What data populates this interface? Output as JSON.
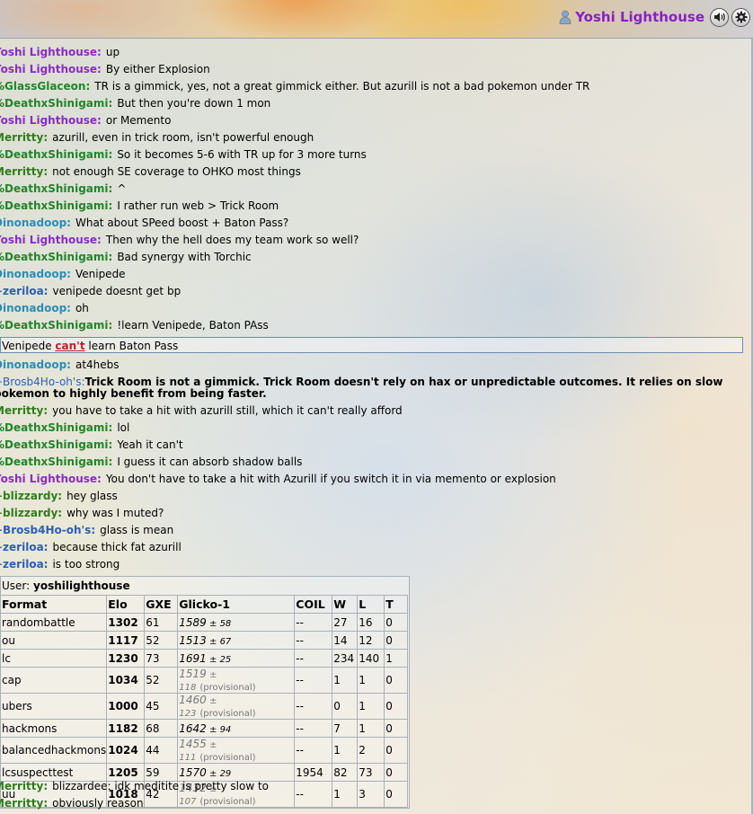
{
  "header": {
    "username": "Yoshi Lighthouse",
    "icons": {
      "user": "user-icon",
      "sound": "sound-icon",
      "settings": "gear-icon"
    },
    "username_color": "#8a1ec9"
  },
  "chat": {
    "messages": [
      {
        "name": "Yoshi Lighthouse:",
        "text": "up",
        "color": "purple"
      },
      {
        "name": "Yoshi Lighthouse:",
        "text": "By either Explosion",
        "color": "purple"
      },
      {
        "name": "%GlassGlaceon:",
        "text": "TR is a gimmick, yes, not a great gimmick either. But azurill is not a bad pokemon under TR",
        "color": "green"
      },
      {
        "name": "%DeathxShinigami:",
        "text": "But then you're down 1 mon",
        "color": "green"
      },
      {
        "name": "Yoshi Lighthouse:",
        "text": "or Memento",
        "color": "purple"
      },
      {
        "name": "Merritty:",
        "text": "azurill, even in trick room, isn't powerful enough",
        "color": "olive"
      },
      {
        "name": "%DeathxShinigami:",
        "text": "So it becomes 5-6 with TR up for 3 more turns",
        "color": "green"
      },
      {
        "name": "Merritty:",
        "text": "not enough SE coverage to OHKO most things",
        "color": "olive"
      },
      {
        "name": "%DeathxShinigami:",
        "text": "^",
        "color": "green"
      },
      {
        "name": "%DeathxShinigami:",
        "text": "I rather run web > Trick Room",
        "color": "green"
      },
      {
        "name": "Dinonadoop:",
        "text": "What about SPeed boost + Baton Pass?",
        "color": "teal"
      },
      {
        "name": "Yoshi Lighthouse:",
        "text": "Then why the hell does my team work so well?",
        "color": "purple"
      },
      {
        "name": "%DeathxShinigami:",
        "text": "Bad synergy with Torchic",
        "color": "green"
      },
      {
        "name": "Dinonadoop:",
        "text": "Venipede",
        "color": "teal"
      },
      {
        "name": "+zeriloa:",
        "text": "venipede doesnt get bp",
        "color": "blue"
      },
      {
        "name": "Dinonadoop:",
        "text": "oh",
        "color": "teal"
      },
      {
        "name": "%DeathxShinigami:",
        "text": "!learn Venipede, Baton PAss",
        "color": "green"
      }
    ],
    "command_output": {
      "before": "Venipede ",
      "cant": "can't",
      "after": " learn Baton Pass"
    },
    "messages2": [
      {
        "name": "Dinonadoop:",
        "text": "at4hebs",
        "color": "teal"
      }
    ],
    "multiline": {
      "name": "+Brosb4Ho-oh's:",
      "line1": "Trick Room is not a gimmick. Trick Room doesn't rely on hax or unpredictable outcomes. It relies on slow",
      "line2": "pokemon to highly benefit from being faster."
    },
    "messages3": [
      {
        "name": "Merritty:",
        "text": "you have to take a hit with azurill still, which it can't really afford",
        "color": "olive"
      },
      {
        "name": "%DeathxShinigami:",
        "text": "lol",
        "color": "green"
      },
      {
        "name": "%DeathxShinigami:",
        "text": "Yeah it can't",
        "color": "green"
      },
      {
        "name": "%DeathxShinigami:",
        "text": "I guess it can absorb shadow balls",
        "color": "green"
      },
      {
        "name": "Yoshi Lighthouse:",
        "text": "You don't have to take a hit with Azurill if you switch it in via memento or explosion",
        "color": "purple"
      },
      {
        "name": "+blizzardy:",
        "text": "hey glass",
        "color": "olive"
      },
      {
        "name": "+blizzardy:",
        "text": "why was I muted?",
        "color": "olive"
      },
      {
        "name": "+Brosb4Ho-oh's:",
        "text": "glass is mean",
        "color": "blue"
      },
      {
        "name": "+zeriloa:",
        "text": "because thick fat azurill",
        "color": "blue"
      },
      {
        "name": "+zeriloa:",
        "text": "is too strong",
        "color": "blue"
      }
    ],
    "messages4": [
      {
        "name": "Merritty:",
        "text": "blizzardee: idk meditite is pretty slow to",
        "color": "olive"
      },
      {
        "name": "Merritty:",
        "text": "obviously reason",
        "color": "olive"
      }
    ]
  },
  "ranking": {
    "user_label": "User:",
    "user": "yoshilighthouse",
    "columns": [
      "Format",
      "Elo",
      "GXE",
      "Glicko-1",
      "COIL",
      "W",
      "L",
      "T"
    ],
    "rows": [
      {
        "format": "randombattle",
        "elo": "1302",
        "gxe": "61",
        "glicko": "1589",
        "dev": "58",
        "prov": "",
        "coil": "--",
        "w": "27",
        "l": "16",
        "t": "0"
      },
      {
        "format": "ou",
        "elo": "1117",
        "gxe": "52",
        "glicko": "1513",
        "dev": "67",
        "prov": "",
        "coil": "--",
        "w": "14",
        "l": "12",
        "t": "0"
      },
      {
        "format": "lc",
        "elo": "1230",
        "gxe": "73",
        "glicko": "1691",
        "dev": "25",
        "prov": "",
        "coil": "--",
        "w": "234",
        "l": "140",
        "t": "1"
      },
      {
        "format": "cap",
        "elo": "1034",
        "gxe": "52",
        "glicko": "1519",
        "dev": "118",
        "prov": "(provisional)",
        "coil": "--",
        "w": "1",
        "l": "1",
        "t": "0"
      },
      {
        "format": "ubers",
        "elo": "1000",
        "gxe": "45",
        "glicko": "1460",
        "dev": "123",
        "prov": "(provisional)",
        "coil": "--",
        "w": "0",
        "l": "1",
        "t": "0"
      },
      {
        "format": "hackmons",
        "elo": "1182",
        "gxe": "68",
        "glicko": "1642",
        "dev": "94",
        "prov": "",
        "coil": "--",
        "w": "7",
        "l": "1",
        "t": "0"
      },
      {
        "format": "balancedhackmons",
        "elo": "1024",
        "gxe": "44",
        "glicko": "1455",
        "dev": "111",
        "prov": "(provisional)",
        "coil": "--",
        "w": "1",
        "l": "2",
        "t": "0"
      },
      {
        "format": "lcsuspecttest",
        "elo": "1205",
        "gxe": "59",
        "glicko": "1570",
        "dev": "29",
        "prov": "",
        "coil": "1954",
        "w": "82",
        "l": "73",
        "t": "0"
      },
      {
        "format": "uu",
        "elo": "1018",
        "gxe": "42",
        "glicko": "1432",
        "dev": "107",
        "prov": "(provisional)",
        "coil": "--",
        "w": "1",
        "l": "3",
        "t": "0"
      }
    ]
  },
  "colors": {
    "purple": "#8a2cc4",
    "green": "#22852a",
    "teal": "#2b8db5",
    "blue": "#2d5fb0",
    "olive": "#2f7d1a",
    "cant": "#c0212a"
  }
}
